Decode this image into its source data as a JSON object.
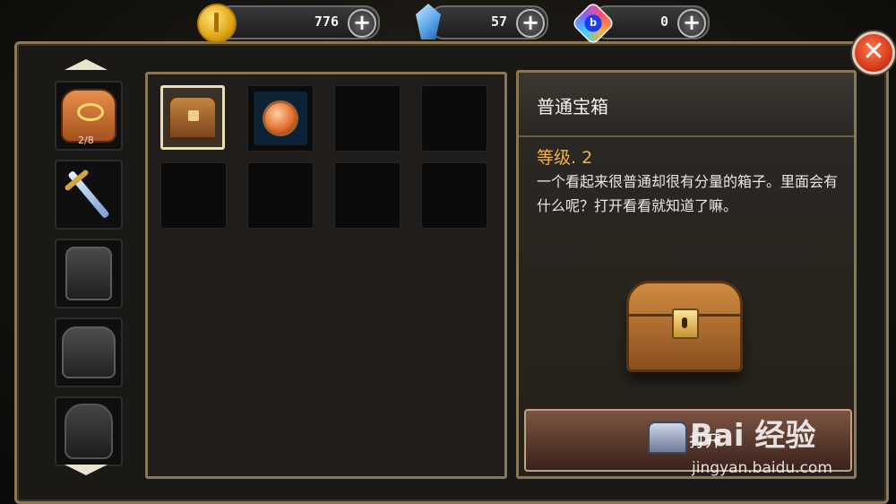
{
  "currency": {
    "gold": {
      "value": "776",
      "icon": "gold-coin-icon"
    },
    "crystal": {
      "value": "57",
      "icon": "blue-crystal-icon"
    },
    "orb": {
      "value": "0",
      "icon": "rainbow-orb-icon",
      "letter": "b"
    },
    "plus_label": "+"
  },
  "close_label": "✕",
  "sidebar": {
    "tabs": [
      {
        "name": "bag",
        "count": "2/8",
        "icon": "backpack-icon"
      },
      {
        "name": "weapon",
        "icon": "sword-icon"
      },
      {
        "name": "helmet",
        "icon": "helmet-icon"
      },
      {
        "name": "armor",
        "icon": "armor-icon"
      },
      {
        "name": "gloves",
        "icon": "glove-icon"
      }
    ]
  },
  "inventory": {
    "slots": [
      {
        "item": "treasure-chest-icon",
        "selected": true
      },
      {
        "item": "amulet-icon",
        "selected": false
      },
      {},
      {},
      {},
      {},
      {},
      {}
    ]
  },
  "detail": {
    "title": "普通宝箱",
    "level": "等级. 2",
    "description": "一个看起来很普通却很有分量的箱子。里面会有什么呢？打开看看就知道了嘛。",
    "open_button": "打开"
  },
  "watermark": {
    "brand": "Bai 经验",
    "url": "jingyan.baidu.com"
  }
}
